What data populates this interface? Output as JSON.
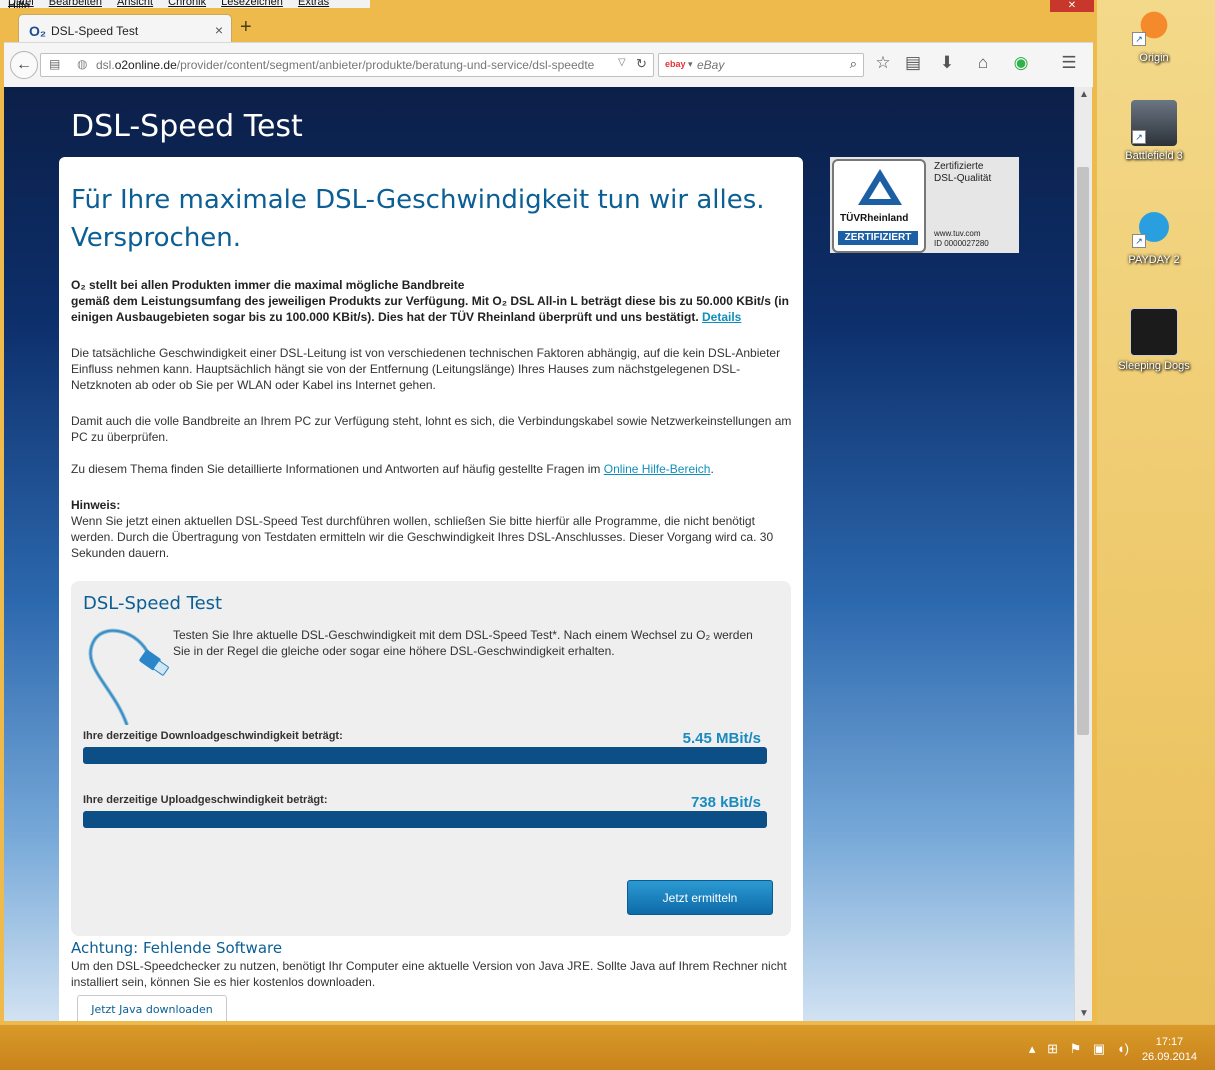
{
  "menubar": [
    "Datei",
    "Bearbeiten",
    "Ansicht",
    "Chronik",
    "Lesezeichen",
    "Extras",
    "Hilfe"
  ],
  "tab": {
    "title": "DSL-Speed Test",
    "favicon": "O₂"
  },
  "address": {
    "url_prefix": "dsl.",
    "url_domain": "o2online.de",
    "url_path": "/provider/content/segment/anbieter/produkte/beratung-und-service/dsl-speedte"
  },
  "search": {
    "engine": "ebay",
    "placeholder": "eBay"
  },
  "page": {
    "title": "DSL-Speed Test",
    "headline": "Für Ihre maximale DSL-Geschwindigkeit tun wir alles. Versprochen.",
    "para1_line1": "O₂ stellt bei allen Produkten immer die maximal mögliche Bandbreite",
    "para1_line2": "gemäß dem Leistungsumfang des jeweiligen Produkts zur Verfügung. Mit O₂ DSL All-in L beträgt diese bis zu 50.000 KBit/s (in einigen Ausbaugebieten sogar bis zu 100.000 KBit/s). Dies hat der TÜV Rheinland überprüft und uns bestätigt.",
    "details_link": "Details",
    "para2": "Die tatsächliche Geschwindigkeit einer DSL-Leitung ist von verschiedenen technischen Faktoren abhängig, auf die kein DSL-Anbieter Einfluss nehmen kann. Hauptsächlich hängt sie von der Entfernung (Leitungslänge) Ihres Hauses zum nächstgelegenen DSL-Netzknoten ab oder ob Sie per WLAN oder Kabel ins Internet gehen.",
    "para3": "Damit auch die volle Bandbreite an Ihrem PC zur Verfügung steht, lohnt es sich, die Verbindungskabel sowie Netzwerkeinstellungen am PC zu überprüfen.",
    "para4_text": "Zu diesem Thema finden Sie detaillierte Informationen und Antworten auf häufig gestellte Fragen im",
    "para4_link": "Online Hilfe-Bereich",
    "hint_title": "Hinweis:",
    "hint_text": "Wenn Sie jetzt einen aktuellen DSL-Speed Test durchführen wollen, schließen Sie bitte hierfür alle Programme, die nicht benötigt werden. Durch die Übertragung von Testdaten ermitteln wir die Geschwindigkeit Ihres DSL-Anschlusses. Dieser Vorgang wird ca. 30 Sekunden dauern."
  },
  "tuv": {
    "brand": "TÜVRheinland",
    "certified": "ZERTIFIZIERT",
    "title_line1": "Zertifizierte",
    "title_line2": "DSL-Qualität",
    "web": "www.tuv.com",
    "id": "ID 0000027280"
  },
  "speedtest": {
    "title": "DSL-Speed Test",
    "intro": "Testen Sie Ihre aktuelle DSL-Geschwindigkeit mit dem DSL-Speed Test*. Nach einem Wechsel zu O₂ werden Sie in der Regel die gleiche oder sogar eine höhere DSL-Geschwindigkeit erhalten.",
    "download_label": "Ihre derzeitige Downloadgeschwindigkeit beträgt:",
    "download_value": "5.45 MBit/s",
    "download_fill": 1.0,
    "upload_label": "Ihre derzeitige Uploadgeschwindigkeit beträgt:",
    "upload_value": "738 kBit/s",
    "upload_fill": 1.0,
    "button": "Jetzt ermitteln"
  },
  "missing": {
    "title": "Achtung: Fehlende Software",
    "text": "Um den DSL-Speedchecker zu nutzen, benötigt Ihr Computer eine aktuelle Version von Java JRE. Sollte Java auf Ihrem Rechner nicht installiert sein, können Sie es hier kostenlos downloaden.",
    "button": "Jetzt Java downloaden"
  },
  "desktop_icons": [
    "Origin",
    "Battlefield 3",
    "PAYDAY 2",
    "Sleeping Dogs"
  ],
  "taskbar": {
    "time": "17:17",
    "date": "26.09.2014"
  },
  "colors": {
    "brand_blue": "#0b5f94",
    "link": "#0f8fbd",
    "bar": "#0b4f86",
    "taskbar": "#d99a29"
  }
}
